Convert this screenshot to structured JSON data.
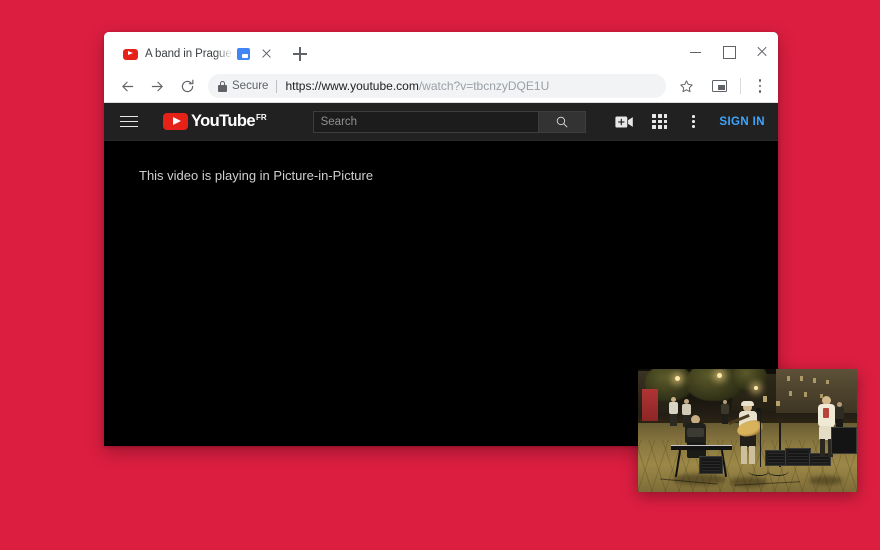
{
  "page": {
    "background_color": "#dc1e41"
  },
  "browser": {
    "tab": {
      "title": "A band in Prague sings th",
      "favicon": "youtube-favicon",
      "pip_badge": "picture-in-picture-active-icon",
      "close_icon": "close-icon"
    },
    "new_tab_icon": "plus-icon",
    "window_controls": {
      "minimize": "minimize-icon",
      "maximize": "maximize-icon",
      "close": "close-icon"
    },
    "toolbar": {
      "back_icon": "back-arrow-icon",
      "forward_icon": "forward-arrow-icon",
      "reload_icon": "reload-icon",
      "lock_icon": "lock-icon",
      "security_label": "Secure",
      "url_host": "https://www.youtube.com",
      "url_path": "/watch?v=tbcnzyDQE1U",
      "bookmark_icon": "star-icon",
      "pip_icon": "picture-in-picture-icon",
      "menu_icon": "three-dot-menu-icon"
    }
  },
  "youtube": {
    "header": {
      "menu_icon": "hamburger-menu-icon",
      "logo_text": "YouTube",
      "logo_superscript": "FR",
      "logo_play_icon": "youtube-play-icon",
      "search_placeholder": "Search",
      "search_value": "",
      "search_button_icon": "search-icon",
      "upload_icon": "video-camera-plus-icon",
      "apps_icon": "apps-grid-icon",
      "more_icon": "vertical-three-dot-icon",
      "sign_in_label": "SIGN IN",
      "sign_in_color": "#3ea6ff"
    },
    "content": {
      "pip_message": "This video is playing in Picture-in-Picture"
    }
  },
  "pip_window": {
    "name": "picture-in-picture-video",
    "scene_description": "Night street scene with a band performing: keyboardist on the left, guitarist in the center, and a third musician on the right, with amplifiers and microphone stands on a patterned pavement."
  }
}
